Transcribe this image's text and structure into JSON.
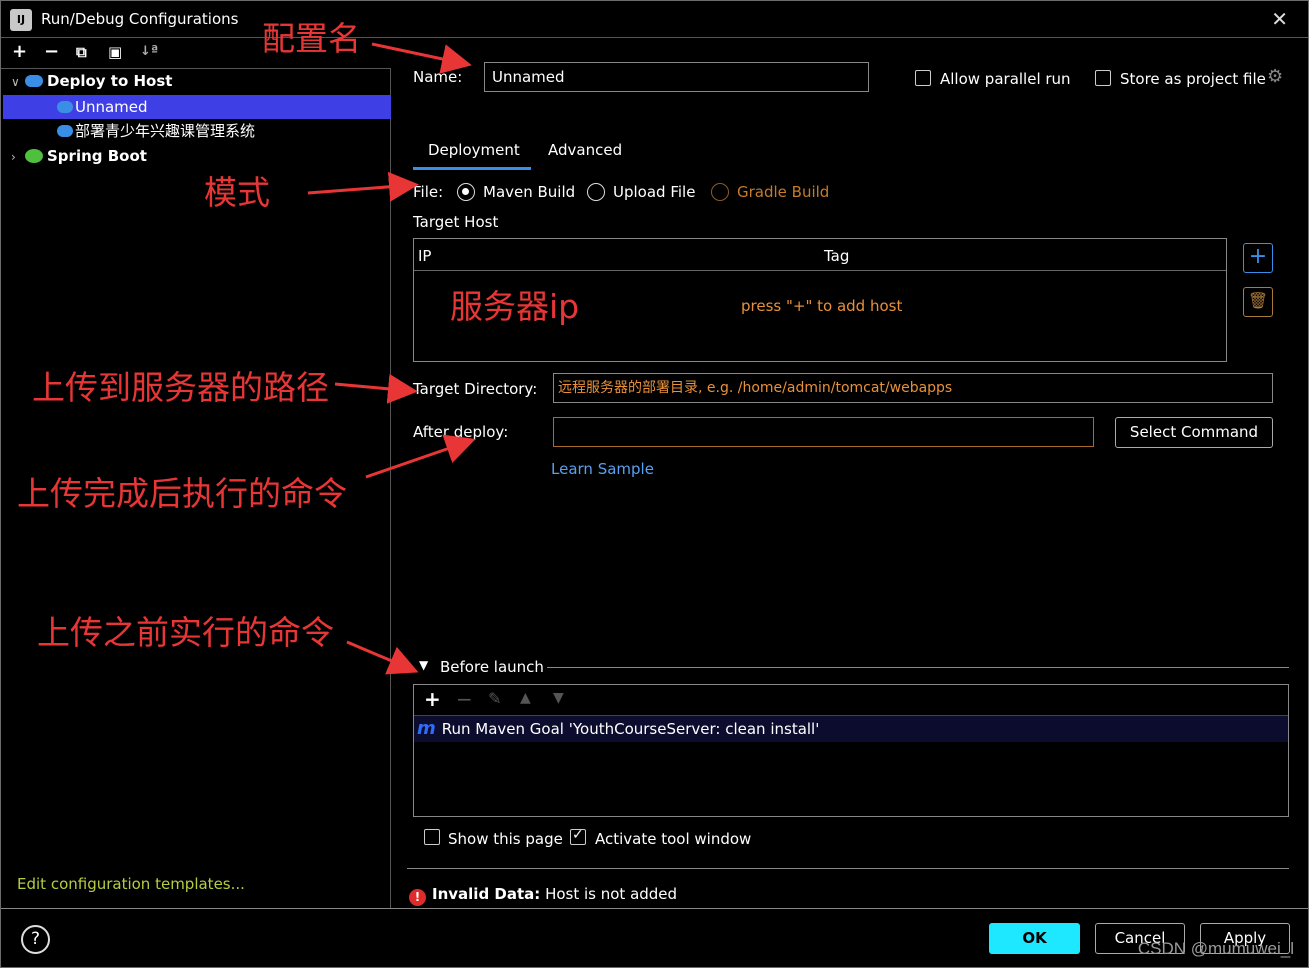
{
  "window": {
    "title": "Run/Debug Configurations",
    "app_icon": "IJ"
  },
  "toolbar": {
    "icons": [
      "+",
      "−",
      "⧉",
      "▣",
      "↓ª"
    ]
  },
  "tree": {
    "groups": [
      {
        "label": "Deploy to Host",
        "expanded": true,
        "icon": "cloud-icon"
      },
      {
        "label": "Spring Boot",
        "expanded": false,
        "icon": "spring-boot-icon"
      }
    ],
    "items": [
      {
        "label": "Unnamed",
        "selected": true
      },
      {
        "label": "部署青少年兴趣课管理系统",
        "selected": false
      }
    ]
  },
  "edit_templates_link": "Edit configuration templates...",
  "name_field": {
    "label": "Name:",
    "value": "Unnamed"
  },
  "options": {
    "allow_parallel_run": "Allow parallel run",
    "store_as_project_file": "Store as project file"
  },
  "tabs": [
    {
      "label": "Deployment",
      "active": true
    },
    {
      "label": "Advanced",
      "active": false
    }
  ],
  "file": {
    "label": "File:",
    "options": [
      {
        "label": "Maven Build",
        "checked": true,
        "disabled": false
      },
      {
        "label": "Upload File",
        "checked": false,
        "disabled": false
      },
      {
        "label": "Gradle Build",
        "checked": false,
        "disabled": true
      }
    ]
  },
  "target_host": {
    "label": "Target Host",
    "columns": [
      "IP",
      "Tag"
    ],
    "empty_text": "press \"+\" to add host"
  },
  "target_directory": {
    "label": "Target Directory:",
    "placeholder": "远程服务器的部署目录, e.g. /home/admin/tomcat/webapps"
  },
  "after_deploy": {
    "label": "After deploy:",
    "value": ""
  },
  "select_command": "Select Command",
  "learn_sample": "Learn Sample",
  "before_launch": {
    "label": "Before launch",
    "tasks": [
      "Run Maven Goal 'YouthCourseServer: clean install'"
    ]
  },
  "show_this_page": {
    "label": "Show this page",
    "checked": false
  },
  "activate_tool_window": {
    "label": "Activate tool window",
    "checked": true
  },
  "error": {
    "label": "Invalid Data:",
    "message": "Host is not added"
  },
  "buttons": {
    "ok": "OK",
    "cancel": "Cancel",
    "apply": "Apply",
    "help": "?"
  },
  "annotations": {
    "config_name": "配置名",
    "mode": "模式",
    "server_ip": "服务器ip",
    "upload_path": "上传到服务器的路径",
    "after_upload_cmd": "上传完成后执行的命令",
    "before_upload_cmd": "上传之前实行的命令"
  },
  "watermark": "CSDN @mumuwei_l",
  "colors": {
    "accent": "#3a8ee6",
    "selection": "#3f3fe6",
    "warning": "#e8903a",
    "link": "#5aa0f0",
    "annotation": "#e83636",
    "ok": "#1ee8ff"
  }
}
